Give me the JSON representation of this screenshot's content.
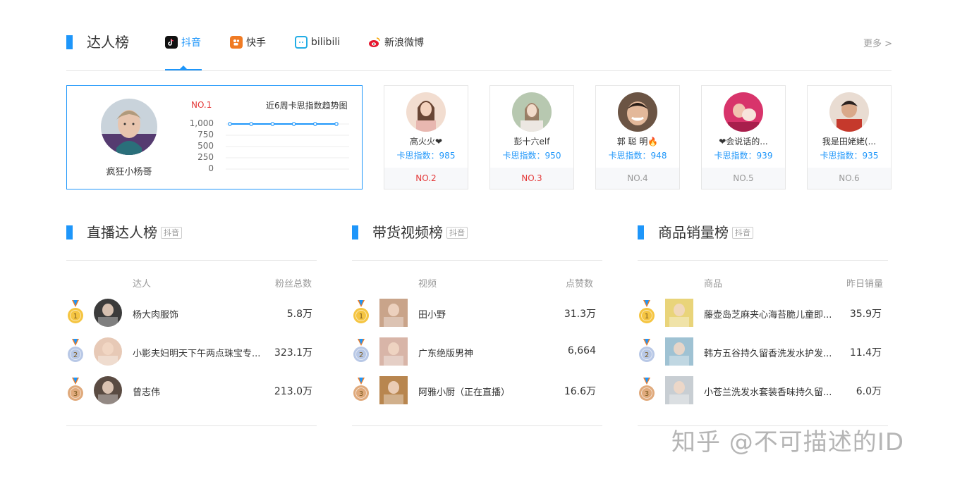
{
  "header": {
    "title": "达人榜",
    "more": "更多 >",
    "tabs": [
      {
        "label": "抖音",
        "icon": "douyin-icon"
      },
      {
        "label": "快手",
        "icon": "kuaishou-icon"
      },
      {
        "label": "bilibili",
        "icon": "bilibili-icon"
      },
      {
        "label": "新浪微博",
        "icon": "weibo-icon"
      }
    ]
  },
  "top_card": {
    "name": "疯狂小杨哥",
    "rank": "NO.1",
    "trend_title": "近6周卡思指数趋势图",
    "yticks": [
      "1,000",
      "750",
      "500",
      "250",
      "0"
    ]
  },
  "chart_data": {
    "type": "line",
    "title": "近6周卡思指数趋势图",
    "xlabel": "",
    "ylabel": "",
    "ylim": [
      0,
      1000
    ],
    "y_ticks": [
      0,
      250,
      500,
      750,
      1000
    ],
    "series": [
      {
        "values": [
          1000,
          1000,
          1000,
          1000,
          1000,
          1000
        ]
      }
    ]
  },
  "rank_cards": [
    {
      "name": "高火火❤",
      "index": "卡思指数：985",
      "no": "NO.2"
    },
    {
      "name": "彭十六elf",
      "index": "卡思指数：950",
      "no": "NO.3"
    },
    {
      "name": "郭 聪 明🔥",
      "index": "卡思指数：948",
      "no": "NO.4"
    },
    {
      "name": "❤会说话的...",
      "index": "卡思指数：939",
      "no": "NO.5"
    },
    {
      "name": "我是田姥姥(...",
      "index": "卡思指数：935",
      "no": "NO.6"
    }
  ],
  "live": {
    "title": "直播达人榜",
    "platform": "抖音",
    "col_left": "达人",
    "col_right": "粉丝总数",
    "rows": [
      {
        "name": "杨大肉服饰",
        "value": "5.8万"
      },
      {
        "name": "小影夫妇明天下午两点珠宝专...",
        "value": "323.1万"
      },
      {
        "name": "曾志伟",
        "value": "213.0万"
      }
    ]
  },
  "video": {
    "title": "带货视频榜",
    "platform": "抖音",
    "col_left": "视频",
    "col_right": "点赞数",
    "rows": [
      {
        "name": "田小野",
        "value": "31.3万"
      },
      {
        "name": "广东绝版男神",
        "value": "6,664"
      },
      {
        "name": "阿雅小厨（正在直播）",
        "value": "16.6万"
      }
    ]
  },
  "goods": {
    "title": "商品销量榜",
    "platform": "抖音",
    "col_left": "商品",
    "col_right": "昨日销量",
    "rows": [
      {
        "name": "藤壶岛芝麻夹心海苔脆儿童即...",
        "value": "35.9万"
      },
      {
        "name": "韩方五谷持久留香洗发水护发...",
        "value": "11.4万"
      },
      {
        "name": "小苍兰洗发水套装香味持久留...",
        "value": "6.0万"
      }
    ]
  },
  "medals": [
    "1",
    "2",
    "3"
  ],
  "watermark": "知乎 @不可描述的ID",
  "colors": {
    "accent": "#1e96fa",
    "rank_red": "#e43a3a",
    "gold": "#f5c542",
    "silver": "#b8c8e6",
    "bronze": "#e0aa7c"
  }
}
